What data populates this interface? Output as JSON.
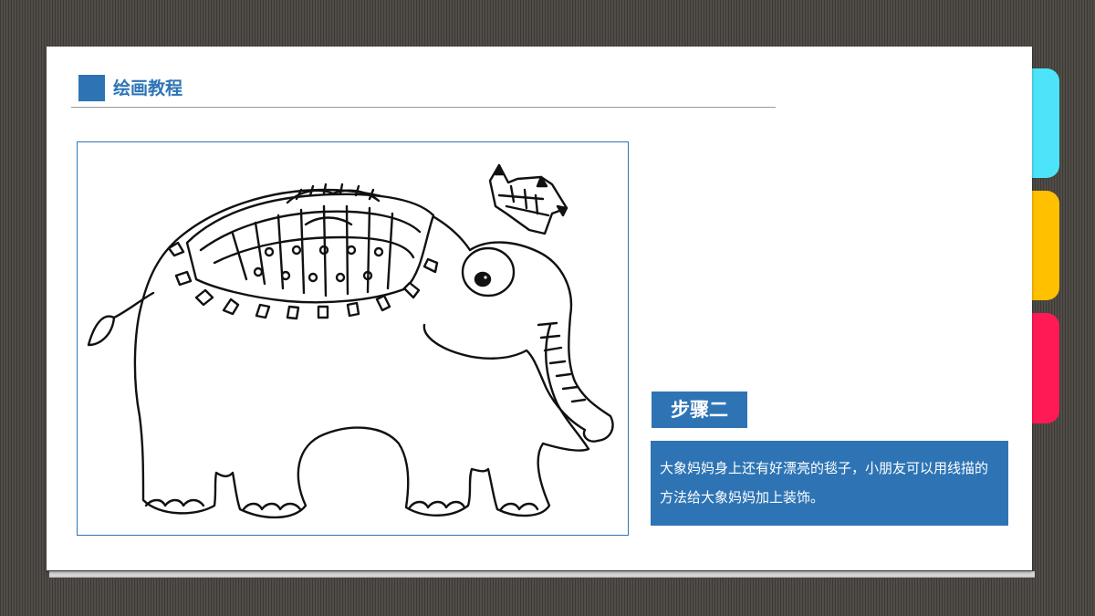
{
  "header": {
    "title": "绘画教程"
  },
  "step": {
    "label": "步骤二",
    "description": "大象妈妈身上还有好漂亮的毯子，小朋友可以用线描的方法给大象妈妈加上装饰。"
  },
  "illustration": {
    "subject": "elephant-with-crown-line-drawing"
  },
  "colors": {
    "accent": "#2e74b5",
    "tab_cyan": "#4de4f9",
    "tab_yellow": "#ffc000",
    "tab_pink": "#ff1a55",
    "background": "#4a4641"
  }
}
